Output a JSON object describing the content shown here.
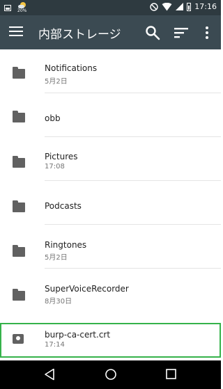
{
  "status_bar": {
    "weather_percent": "20%",
    "time": "17:16",
    "icons": [
      "image-notification-icon",
      "weather-icon",
      "do-not-disturb-icon",
      "wifi-icon",
      "signal-icon",
      "battery-icon"
    ]
  },
  "toolbar": {
    "title": "内部ストレージ",
    "icons": [
      "menu-icon",
      "search-icon",
      "sort-icon",
      "more-vert-icon"
    ],
    "bg_color": "#3b4a52"
  },
  "files": [
    {
      "name": "Notifications",
      "subtitle": "5月2日",
      "type": "folder"
    },
    {
      "name": "obb",
      "subtitle": "",
      "type": "folder"
    },
    {
      "name": "Pictures",
      "subtitle": "17:08",
      "type": "folder"
    },
    {
      "name": "Podcasts",
      "subtitle": "",
      "type": "folder"
    },
    {
      "name": "Ringtones",
      "subtitle": "5月2日",
      "type": "folder"
    },
    {
      "name": "SuperVoiceRecorder",
      "subtitle": "8月30日",
      "type": "folder"
    },
    {
      "name": "burp-ca-cert.crt",
      "subtitle": "17:14",
      "type": "certificate",
      "highlighted": true
    }
  ],
  "highlight_color": "#35b24a",
  "nav_bar": {
    "icons": [
      "back-icon",
      "home-icon",
      "recents-icon"
    ]
  }
}
